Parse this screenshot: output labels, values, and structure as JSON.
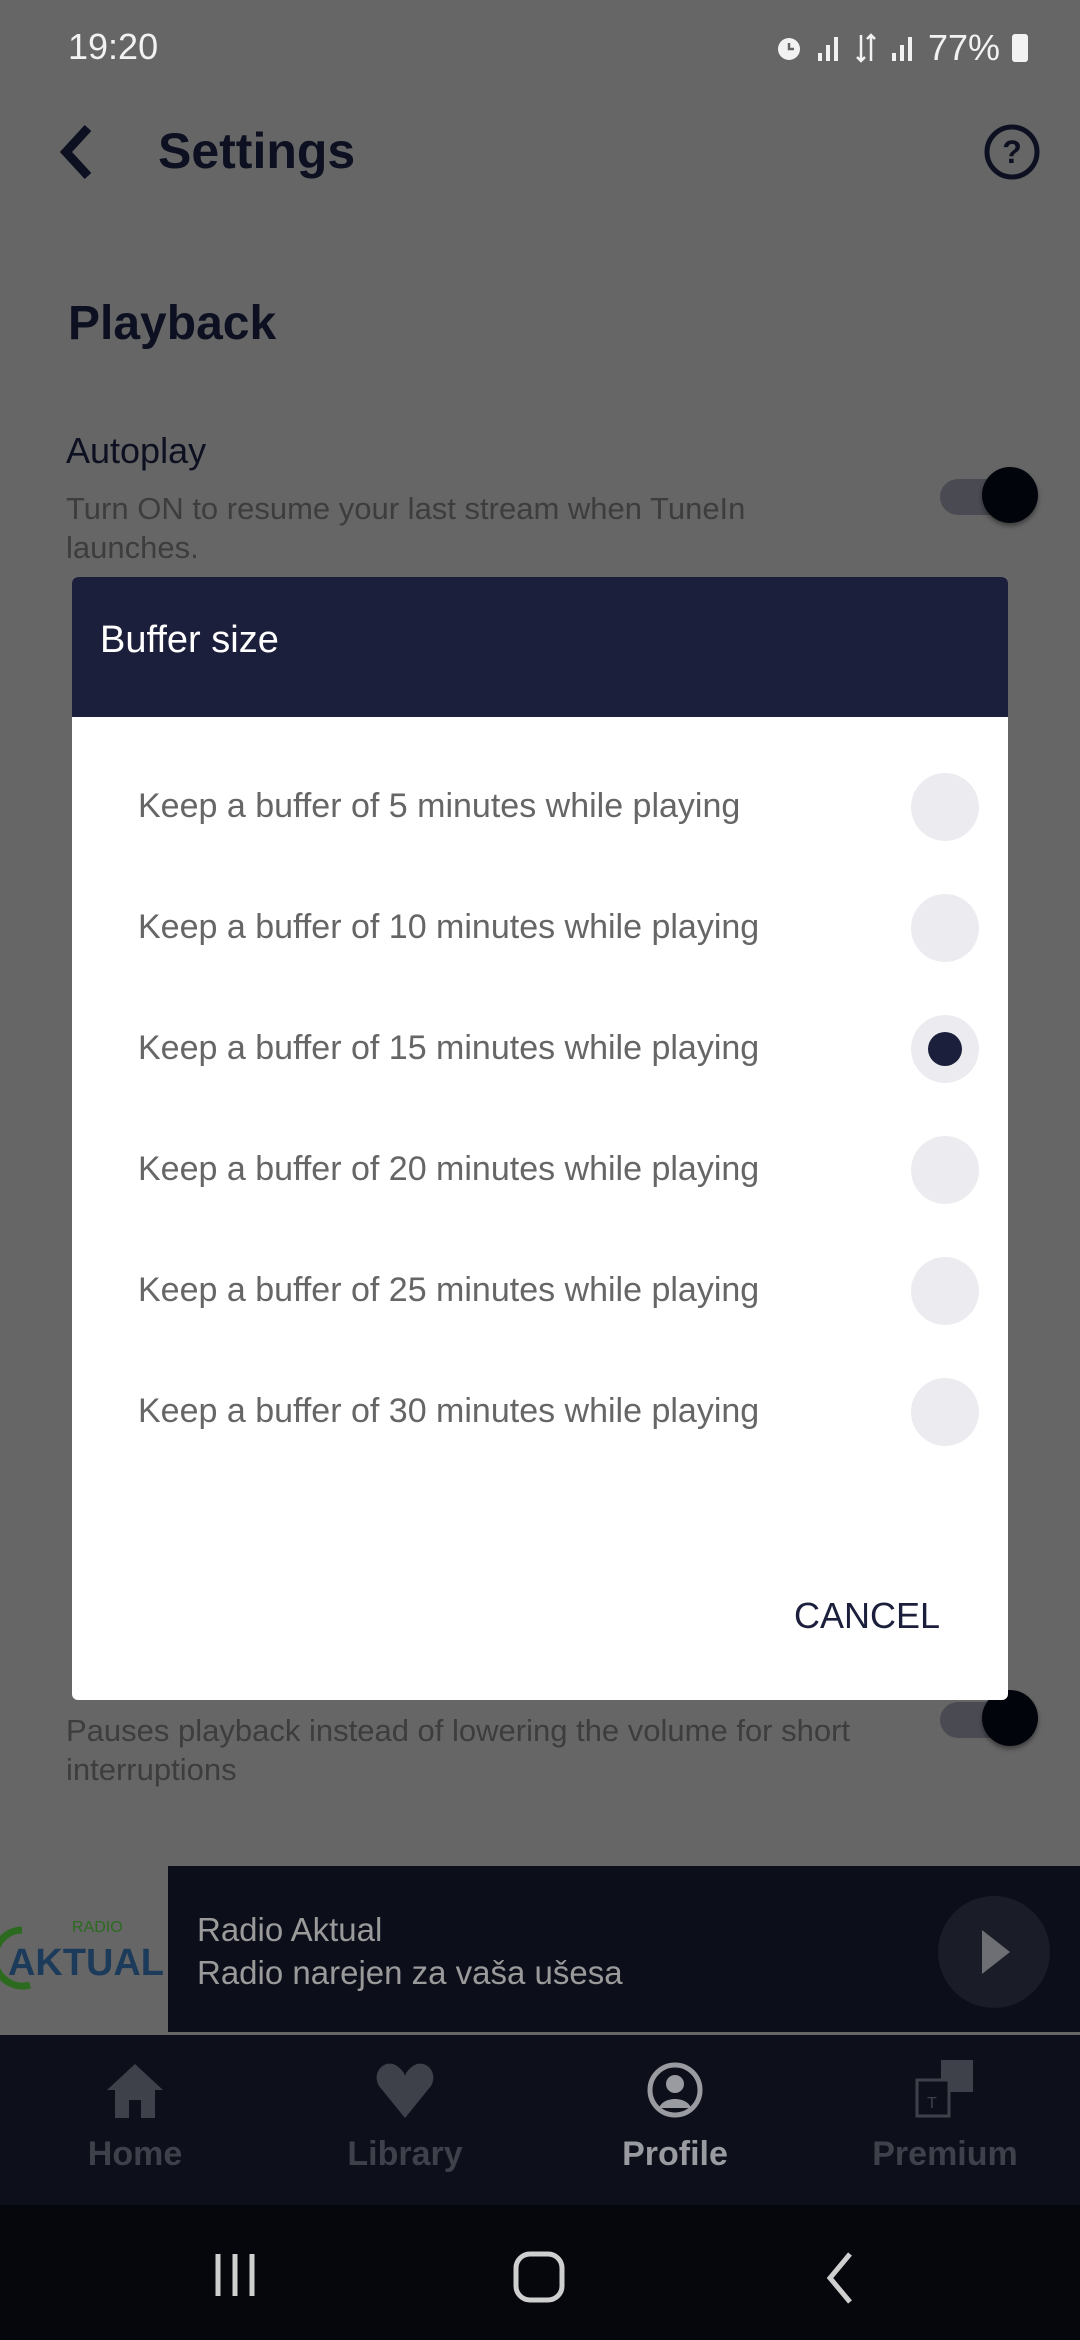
{
  "status_bar": {
    "time": "19:20",
    "battery": "77%"
  },
  "header": {
    "title": "Settings",
    "back_icon": "chevron-left-icon",
    "help_icon": "help-circle-icon"
  },
  "section": {
    "title": "Playback"
  },
  "settings": [
    {
      "title": "Autoplay",
      "desc": "Turn ON to resume your last stream when TuneIn launches.",
      "enabled": true
    },
    {
      "desc": "Pauses playback instead of lowering the volume for short interruptions",
      "enabled": true
    }
  ],
  "dialog": {
    "title": "Buffer size",
    "options": [
      {
        "label": "Keep a buffer of 5 minutes while playing",
        "selected": false
      },
      {
        "label": "Keep a buffer of 10 minutes while playing",
        "selected": false
      },
      {
        "label": "Keep a buffer of 15 minutes while playing",
        "selected": true
      },
      {
        "label": "Keep a buffer of 20 minutes while playing",
        "selected": false
      },
      {
        "label": "Keep a buffer of 25 minutes while playing",
        "selected": false
      },
      {
        "label": "Keep a buffer of 30 minutes while playing",
        "selected": false
      }
    ],
    "cancel_label": "CANCEL"
  },
  "mini_player": {
    "logo_text": "RADIO AKTUAL",
    "title": "Radio Aktual",
    "subtitle": "Radio narejen za vaša ušesa",
    "play_icon": "play-icon"
  },
  "bottom_nav": [
    {
      "label": "Home",
      "icon": "home-icon",
      "active": false
    },
    {
      "label": "Library",
      "icon": "heart-icon",
      "active": false
    },
    {
      "label": "Profile",
      "icon": "profile-icon",
      "active": true
    },
    {
      "label": "Premium",
      "icon": "premium-icon",
      "active": false
    }
  ],
  "colors": {
    "navy": "#1c1f3b",
    "overlay": "#666666",
    "radio_bg": "#ececf0"
  }
}
